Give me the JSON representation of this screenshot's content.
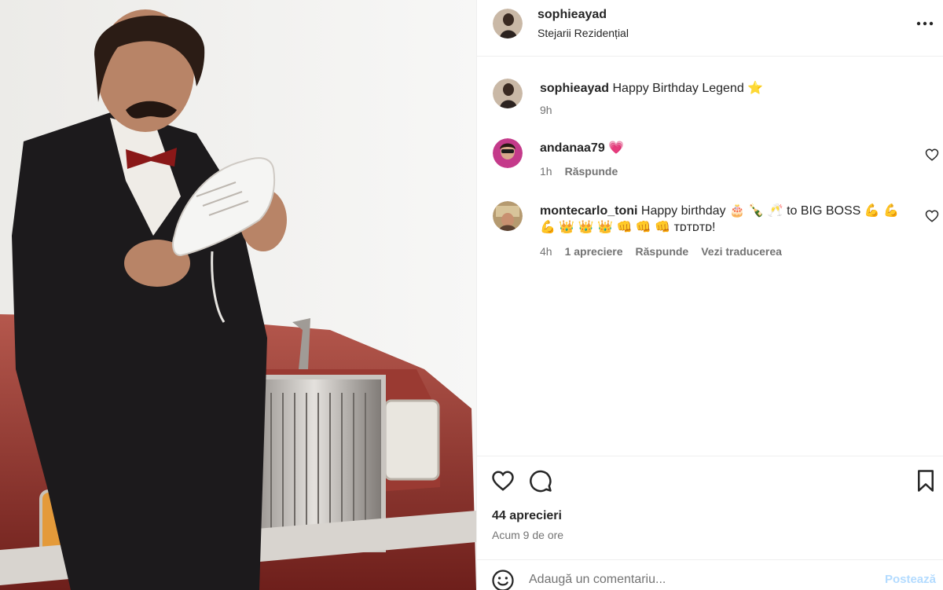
{
  "post": {
    "author": "sophieayad",
    "location": "Stejarii Rezidențial"
  },
  "caption": {
    "user": "sophieayad",
    "text": "Happy Birthday Legend ⭐",
    "time": "9h"
  },
  "comments": [
    {
      "user": "andanaa79",
      "text": "💗",
      "time": "1h",
      "reply_label": "Răspunde"
    },
    {
      "user": "montecarlo_toni",
      "text": "Happy birthday 🎂 🍾 🥂 to BIG BOSS 💪 💪 💪 👑 👑 👑 👊 👊 👊 ᴛᴅᴛᴅᴛᴅ!",
      "time": "4h",
      "likes_label": "1 apreciere",
      "reply_label": "Răspunde",
      "translate_label": "Vezi traducerea"
    }
  ],
  "stats": {
    "likes": "44 aprecieri",
    "posted": "Acum 9 de ore"
  },
  "composer": {
    "placeholder": "Adaugă un comentariu...",
    "post_label": "Postează"
  },
  "icons": {
    "more": "more-options-icon",
    "heart": "heart-icon",
    "comment": "comment-icon",
    "save": "bookmark-icon",
    "emoji": "emoji-icon"
  },
  "colors": {
    "text": "#262626",
    "secondary": "#737373",
    "divider": "#efefef",
    "post_disabled": "#b3dbff"
  }
}
